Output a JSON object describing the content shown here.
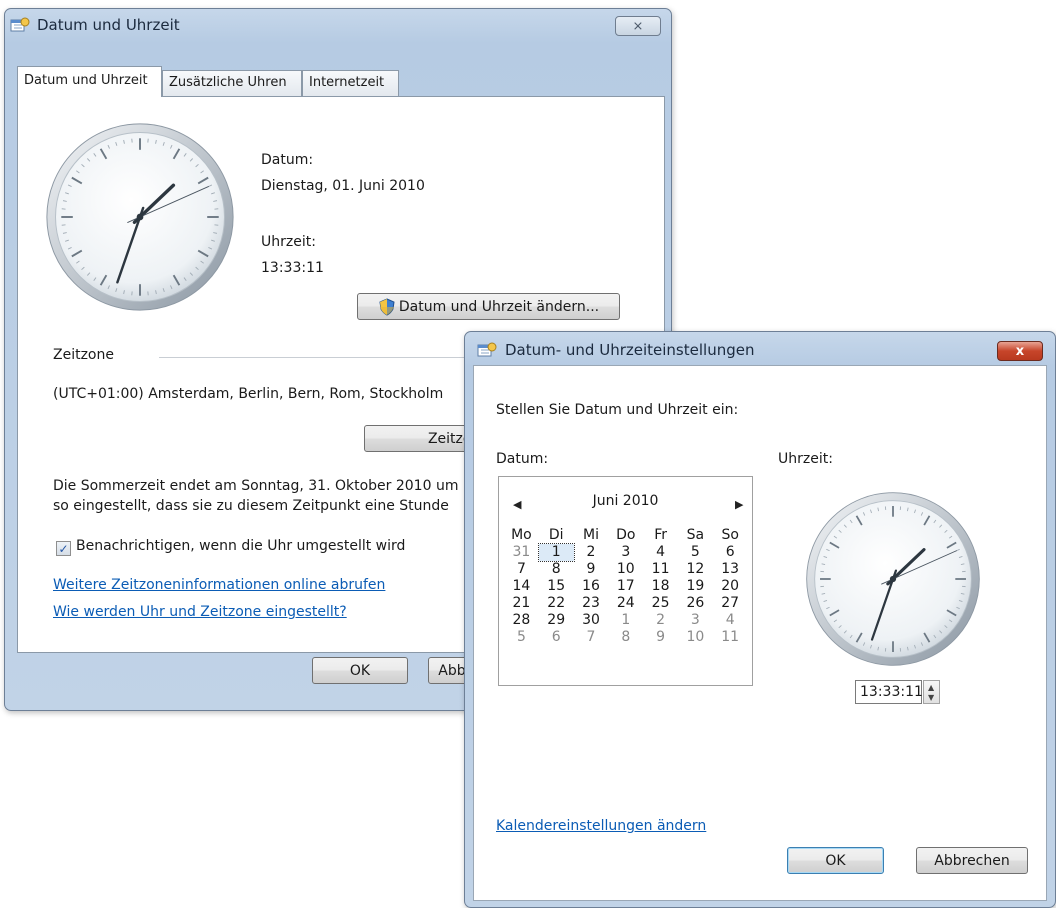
{
  "main_window": {
    "title": "Datum und Uhrzeit",
    "close_label": "⨯",
    "tabs": [
      {
        "label": "Datum und Uhrzeit",
        "active": true
      },
      {
        "label": "Zusätzliche Uhren",
        "active": false
      },
      {
        "label": "Internetzeit",
        "active": false
      }
    ],
    "date_label": "Datum:",
    "date_value": "Dienstag, 01. Juni 2010",
    "time_label": "Uhrzeit:",
    "time_value": "13:33:11",
    "change_button": "Datum und Uhrzeit ändern...",
    "timezone_header": "Zeitzone",
    "timezone_value": "(UTC+01:00) Amsterdam, Berlin, Bern, Rom, Stockholm",
    "timezone_button": "Zeitzone ändern...",
    "dst_line1": "Die Sommerzeit endet am Sonntag, 31. Oktober 2010 um",
    "dst_line2": "so eingestellt, dass sie zu diesem Zeitpunkt eine Stunde",
    "notify_checkbox": {
      "label": "Benachrichtigen, wenn die Uhr umgestellt wird",
      "checked": true,
      "mark": "✓"
    },
    "link_more_info": "Weitere Zeitzoneninformationen online abrufen",
    "link_how": "Wie werden Uhr und Zeitzone eingestellt?",
    "ok_button": "OK",
    "cancel_button": "Abbrechen",
    "clock": {
      "hour": 13,
      "minute": 33,
      "second": 11
    }
  },
  "settings_dialog": {
    "title": "Datum- und Uhrzeiteinstellungen",
    "close_label": "x",
    "instruction": "Stellen Sie Datum und Uhrzeit ein:",
    "date_label": "Datum:",
    "time_label": "Uhrzeit:",
    "calendar": {
      "prev_arrow": "◀",
      "next_arrow": "▶",
      "month_label": "Juni 2010",
      "weekdays": [
        "Mo",
        "Di",
        "Mi",
        "Do",
        "Fr",
        "Sa",
        "So"
      ],
      "weeks": [
        [
          {
            "d": "31",
            "o": true
          },
          {
            "d": "1",
            "sel": true
          },
          {
            "d": "2"
          },
          {
            "d": "3"
          },
          {
            "d": "4"
          },
          {
            "d": "5"
          },
          {
            "d": "6"
          }
        ],
        [
          {
            "d": "7"
          },
          {
            "d": "8"
          },
          {
            "d": "9"
          },
          {
            "d": "10"
          },
          {
            "d": "11"
          },
          {
            "d": "12"
          },
          {
            "d": "13"
          }
        ],
        [
          {
            "d": "14"
          },
          {
            "d": "15"
          },
          {
            "d": "16"
          },
          {
            "d": "17"
          },
          {
            "d": "18"
          },
          {
            "d": "19"
          },
          {
            "d": "20"
          }
        ],
        [
          {
            "d": "21"
          },
          {
            "d": "22"
          },
          {
            "d": "23"
          },
          {
            "d": "24"
          },
          {
            "d": "25"
          },
          {
            "d": "26"
          },
          {
            "d": "27"
          }
        ],
        [
          {
            "d": "28"
          },
          {
            "d": "29"
          },
          {
            "d": "30"
          },
          {
            "d": "1",
            "o": true
          },
          {
            "d": "2",
            "o": true
          },
          {
            "d": "3",
            "o": true
          },
          {
            "d": "4",
            "o": true
          }
        ],
        [
          {
            "d": "5",
            "o": true
          },
          {
            "d": "6",
            "o": true
          },
          {
            "d": "7",
            "o": true
          },
          {
            "d": "8",
            "o": true
          },
          {
            "d": "9",
            "o": true
          },
          {
            "d": "10",
            "o": true
          },
          {
            "d": "11",
            "o": true
          }
        ]
      ]
    },
    "time_input": "13:33:11",
    "spin_up": "▲",
    "spin_down": "▼",
    "calendar_settings_link": "Kalendereinstellungen ändern",
    "ok_button": "OK",
    "cancel_button": "Abbrechen",
    "clock": {
      "hour": 13,
      "minute": 33,
      "second": 11
    }
  },
  "colors": {
    "link": "#0b5cb5",
    "frame": "#b6cbe3",
    "close_red": "#c7452a"
  }
}
